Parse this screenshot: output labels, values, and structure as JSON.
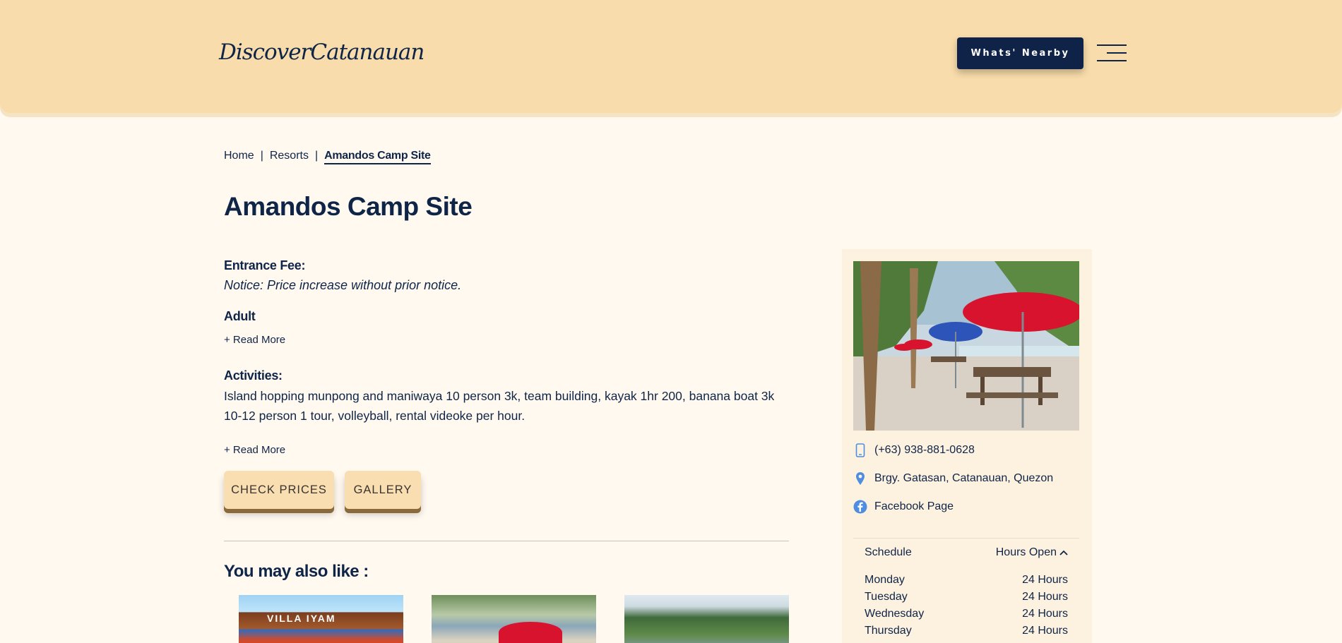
{
  "header": {
    "logo": "DiscoverCatanauan",
    "nearby_button": "Whats' Nearby"
  },
  "breadcrumb": {
    "items": [
      "Home",
      "Resorts",
      "Amandos Camp Site"
    ],
    "separator": "|"
  },
  "main": {
    "title": "Amandos Camp Site",
    "entrance_fee_label": "Entrance Fee:",
    "notice": "Notice: Price increase without prior notice.",
    "adult_label": "Adult",
    "read_more_1": "+ Read More",
    "activities_label": "Activities:",
    "activities_text": "Island hopping munpong and maniwaya 10 person 3k, team building, kayak 1hr 200, banana boat 3k 10-12 person 1 tour, volleyball, rental videoke per hour.",
    "read_more_2": "+ Read More",
    "check_prices_button": "CHECK PRICES",
    "gallery_button": "GALLERY",
    "also_like_heading": "You may also like :",
    "thumb1_sign": "VILLA IYAM"
  },
  "sidebar": {
    "phone": "(+63) 938-881-0628",
    "address": "Brgy. Gatasan, Catanauan, Quezon",
    "facebook": "Facebook Page",
    "schedule_label": "Schedule",
    "hours_open_label": "Hours Open",
    "schedule": [
      {
        "day": "Monday",
        "hours": "24 Hours"
      },
      {
        "day": "Tuesday",
        "hours": "24 Hours"
      },
      {
        "day": "Wednesday",
        "hours": "24 Hours"
      },
      {
        "day": "Thursday",
        "hours": "24 Hours"
      }
    ]
  },
  "colors": {
    "header_bg": "#f8dcab",
    "page_bg": "#fff9f0",
    "navy": "#0f2547",
    "button_bg": "#f8deb1",
    "icon_blue": "#4f8de0"
  },
  "icons": [
    "menu-icon",
    "phone-icon",
    "location-pin-icon",
    "facebook-icon",
    "chevron-up-icon"
  ]
}
